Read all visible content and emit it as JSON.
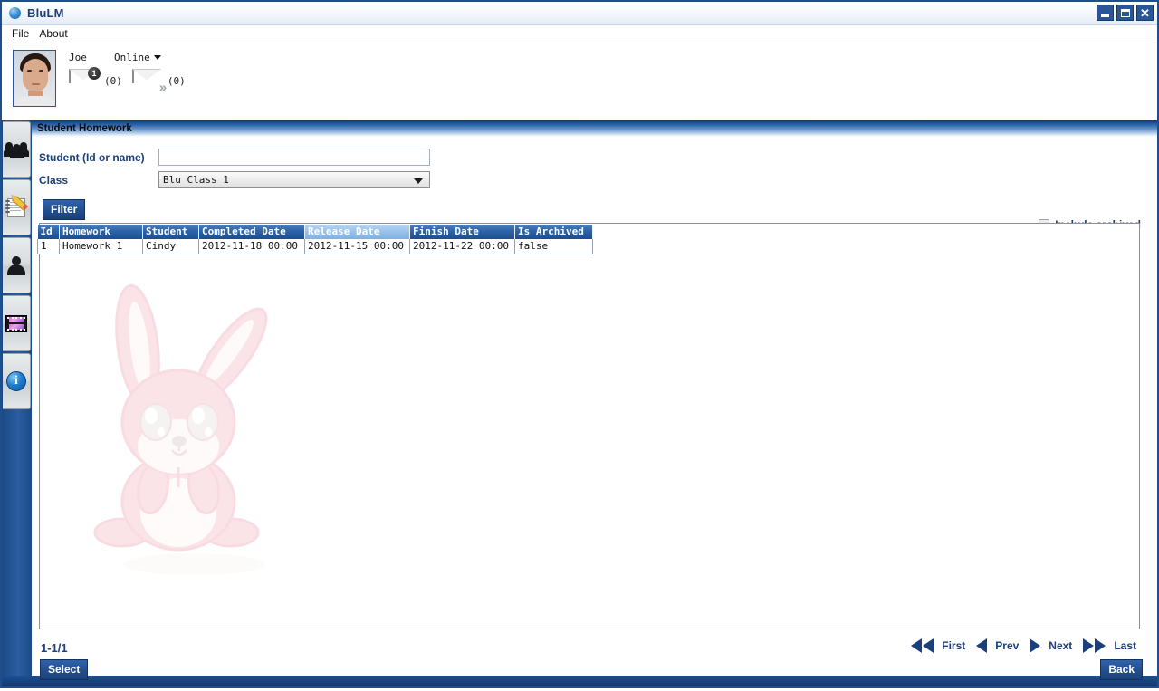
{
  "window": {
    "title": "BluLM",
    "icon": "globe-icon",
    "controls": {
      "minimize": "minimize-icon",
      "maximize": "restore-icon",
      "close": "close-icon"
    }
  },
  "menubar": {
    "items": [
      {
        "label": "File"
      },
      {
        "label": "About"
      }
    ]
  },
  "user": {
    "avatar_alt": "user-avatar",
    "name": "Joe",
    "status": "Online",
    "status_caret": "chevron-down-icon",
    "inbox": {
      "icon": "envelope-icon",
      "badge": "1",
      "count": "(0)"
    },
    "sent": {
      "icon": "envelope-sent-icon",
      "count": "(0)"
    }
  },
  "sidebar": {
    "items": [
      {
        "name": "sidebar-item-groups",
        "icon": "people-group-icon"
      },
      {
        "name": "sidebar-item-homework",
        "icon": "notepad-pencil-icon"
      },
      {
        "name": "sidebar-item-students",
        "icon": "person-icon"
      },
      {
        "name": "sidebar-item-media",
        "icon": "film-strip-icon"
      },
      {
        "name": "sidebar-item-info",
        "icon": "info-icon"
      }
    ]
  },
  "section": {
    "title": "Student Homework"
  },
  "form": {
    "student_label": "Student (Id or name)",
    "student_value": "",
    "student_placeholder": "",
    "class_label": "Class",
    "class_value": "Blu Class 1",
    "class_options": [
      "Blu Class 1"
    ],
    "filter_button": "Filter",
    "include_archived_label": "Include archived",
    "include_archived_checked": false
  },
  "table": {
    "columns": [
      {
        "label": "Id",
        "highlight": false
      },
      {
        "label": "Homework",
        "highlight": false
      },
      {
        "label": "Student",
        "highlight": false
      },
      {
        "label": "Completed Date",
        "highlight": false
      },
      {
        "label": "Release Date",
        "highlight": true
      },
      {
        "label": "Finish Date",
        "highlight": false
      },
      {
        "label": "Is Archived",
        "highlight": false
      }
    ],
    "rows": [
      {
        "id": "1",
        "homework": "Homework 1",
        "student": "Cindy",
        "completed_date": "2012-11-18 00:00",
        "release_date": "2012-11-15 00:00",
        "finish_date": "2012-11-22 00:00",
        "is_archived": "false"
      }
    ]
  },
  "watermark": {
    "name": "bunny-mascot-image",
    "colors": {
      "fur": "#f2a8b4",
      "fur_light": "#fdeef0",
      "outline": "#e88fa0"
    }
  },
  "footer": {
    "page_indicator": "1-1/1",
    "select_button": "Select",
    "back_button": "Back",
    "pager": {
      "first": "First",
      "prev": "Prev",
      "next": "Next",
      "last": "Last"
    }
  },
  "colors": {
    "accent": "#1b3f7d",
    "header_blue": "#2d63a8",
    "highlight_blue": "#9cc3ea",
    "frame_blue": "#1f4e8c"
  }
}
